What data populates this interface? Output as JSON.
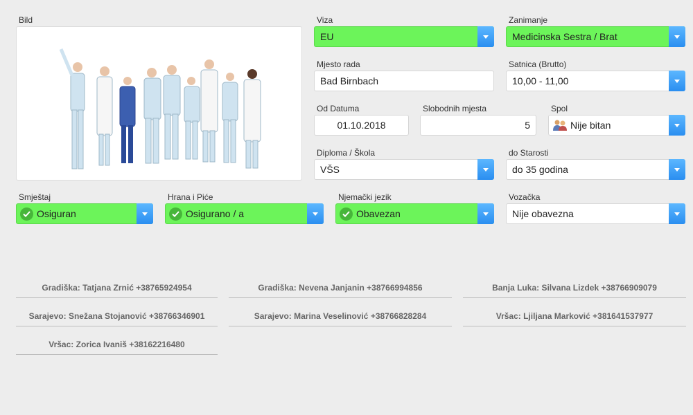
{
  "image": {
    "label": "Bild"
  },
  "fields": {
    "viza": {
      "label": "Viza",
      "value": "EU"
    },
    "zanimanje": {
      "label": "Zanimanje",
      "value": "Medicinska Sestra / Brat"
    },
    "mjesto_rada": {
      "label": "Mjesto rada",
      "value": "Bad Birnbach"
    },
    "satnica": {
      "label": "Satnica (Brutto)",
      "value": "10,00 - 11,00"
    },
    "od_datuma": {
      "label": "Od Datuma",
      "value": "01.10.2018"
    },
    "slobodnih_mjesta": {
      "label": "Slobodnih mjesta",
      "value": "5"
    },
    "spol": {
      "label": "Spol",
      "value": "Nije bitan"
    },
    "diploma": {
      "label": "Diploma / Škola",
      "value": "VŠS"
    },
    "do_starosti": {
      "label": "do Starosti",
      "value": "do 35 godina"
    },
    "smjestaj": {
      "label": "Smještaj",
      "value": "Osiguran"
    },
    "hrana": {
      "label": "Hrana i Piće",
      "value": "Osigurano / a"
    },
    "njemacki": {
      "label": "Njemački jezik",
      "value": "Obavezan"
    },
    "vozacka": {
      "label": "Vozačka",
      "value": "Nije obavezna"
    }
  },
  "colors": {
    "selected_green": "#6cf45a",
    "arrow_blue": "#2a8ef0",
    "check_green": "#47b63a"
  },
  "contacts": [
    "Gradiška: Tatjana Zrnić +38765924954",
    "Gradiška: Nevena Janjanin +38766994856",
    "Banja Luka: Silvana Lizdek +38766909079",
    "Sarajevo: Snežana Stojanović +38766346901",
    "Sarajevo: Marina Veselinović +38766828284",
    "Vršac: Ljiljana Marković +381641537977",
    "Vršac: Zorica Ivaniš +38162216480"
  ]
}
